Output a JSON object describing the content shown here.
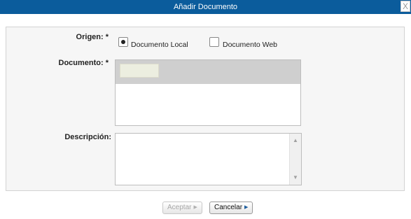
{
  "dialog": {
    "title": "Añadir Documento",
    "close_glyph": "X"
  },
  "form": {
    "origin": {
      "label": "Origen: *",
      "options": [
        {
          "label": "Documento Local",
          "selected": true
        },
        {
          "label": "Documento Web",
          "selected": false
        }
      ]
    },
    "document": {
      "label": "Documento: *"
    },
    "description": {
      "label": "Descripción:",
      "value": ""
    }
  },
  "buttons": {
    "accept_label": "Aceptar",
    "accept_disabled": true,
    "cancel_label": "Cancelar"
  },
  "icons": {
    "close": "close-icon",
    "radio": "radio-icon",
    "arrow": "triangle-right-icon",
    "scroll_up": "chevron-up-icon",
    "scroll_down": "chevron-down-icon"
  },
  "colors": {
    "titlebar": "#0b5c9c",
    "panel": "#f6f6f6",
    "doc_header": "#cfcfcf"
  }
}
